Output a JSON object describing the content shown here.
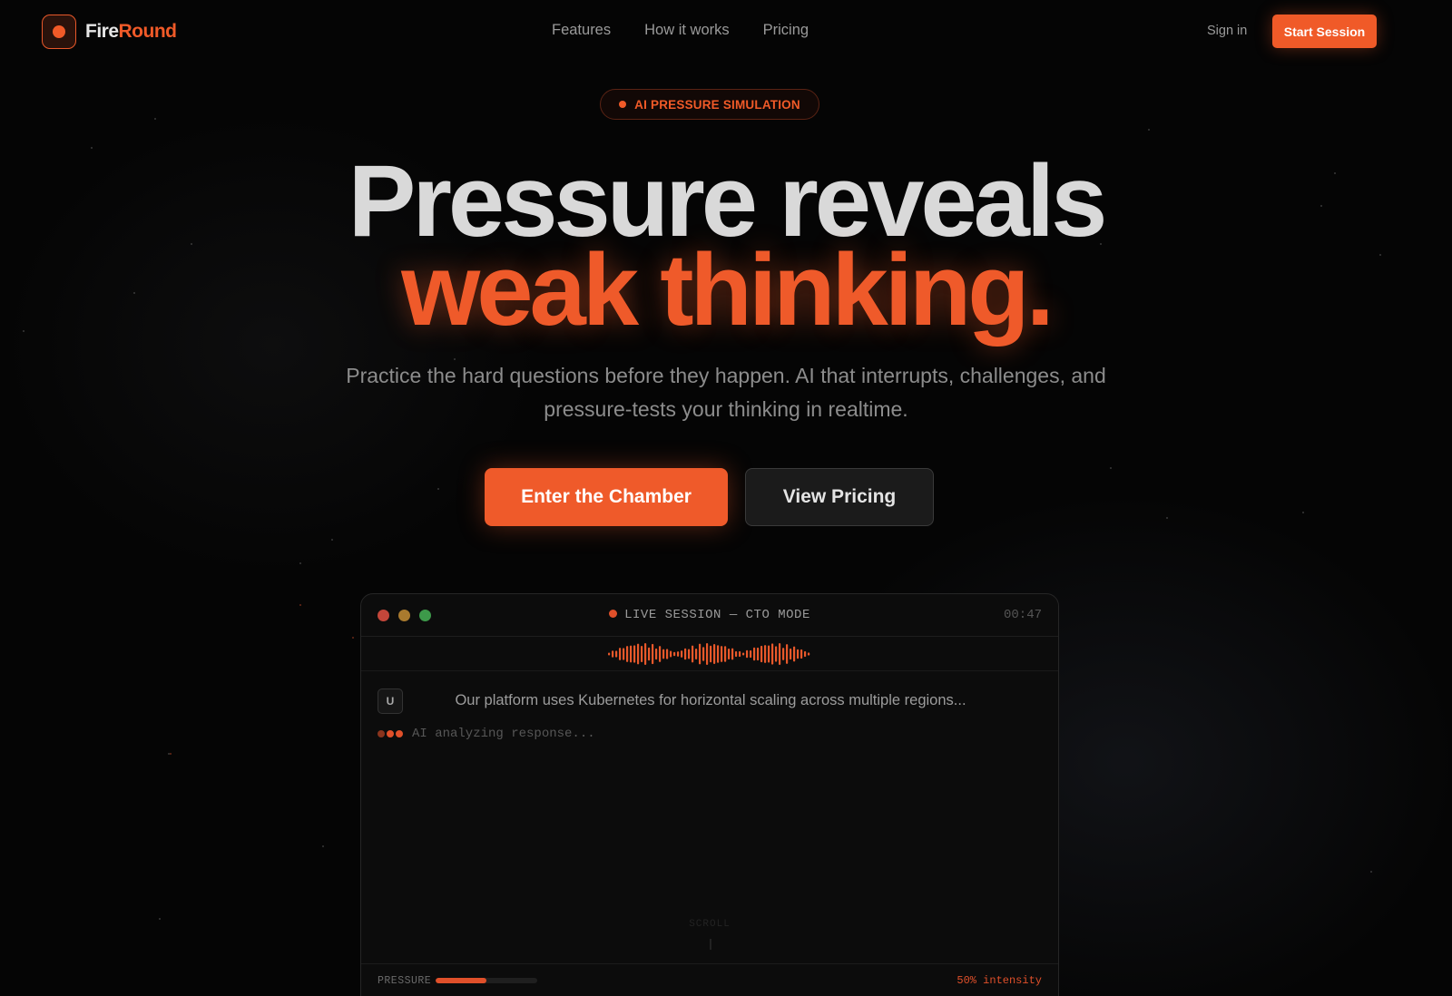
{
  "brand": {
    "name_part1": "Fire",
    "name_part2": "Round",
    "accent_color": "#f05a28",
    "logo_icon": "record-dot-icon"
  },
  "nav": {
    "links": [
      "Features",
      "How it works",
      "Pricing"
    ],
    "sign_in": "Sign in",
    "start_session": "Start Session"
  },
  "badge": {
    "label": "AI PRESSURE SIMULATION"
  },
  "hero": {
    "line1": "Pressure reveals",
    "line2": "weak thinking.",
    "subtitle": "Practice the hard questions before they happen. AI that interrupts, challenges, and pressure-tests your thinking in realtime.",
    "primary_cta": "Enter the Chamber",
    "secondary_cta": "View Pricing"
  },
  "session": {
    "title": "LIVE SESSION — CTO MODE",
    "timer": "00:47",
    "user_avatar": "U",
    "user_message": "Our platform uses Kubernetes for horizontal scaling across multiple regions...",
    "ai_status": "AI analyzing response...",
    "scroll_hint": "SCROLL",
    "pressure_label": "PRESSURE",
    "pressure_fraction": 0.5,
    "intensity_label": "50% intensity"
  }
}
